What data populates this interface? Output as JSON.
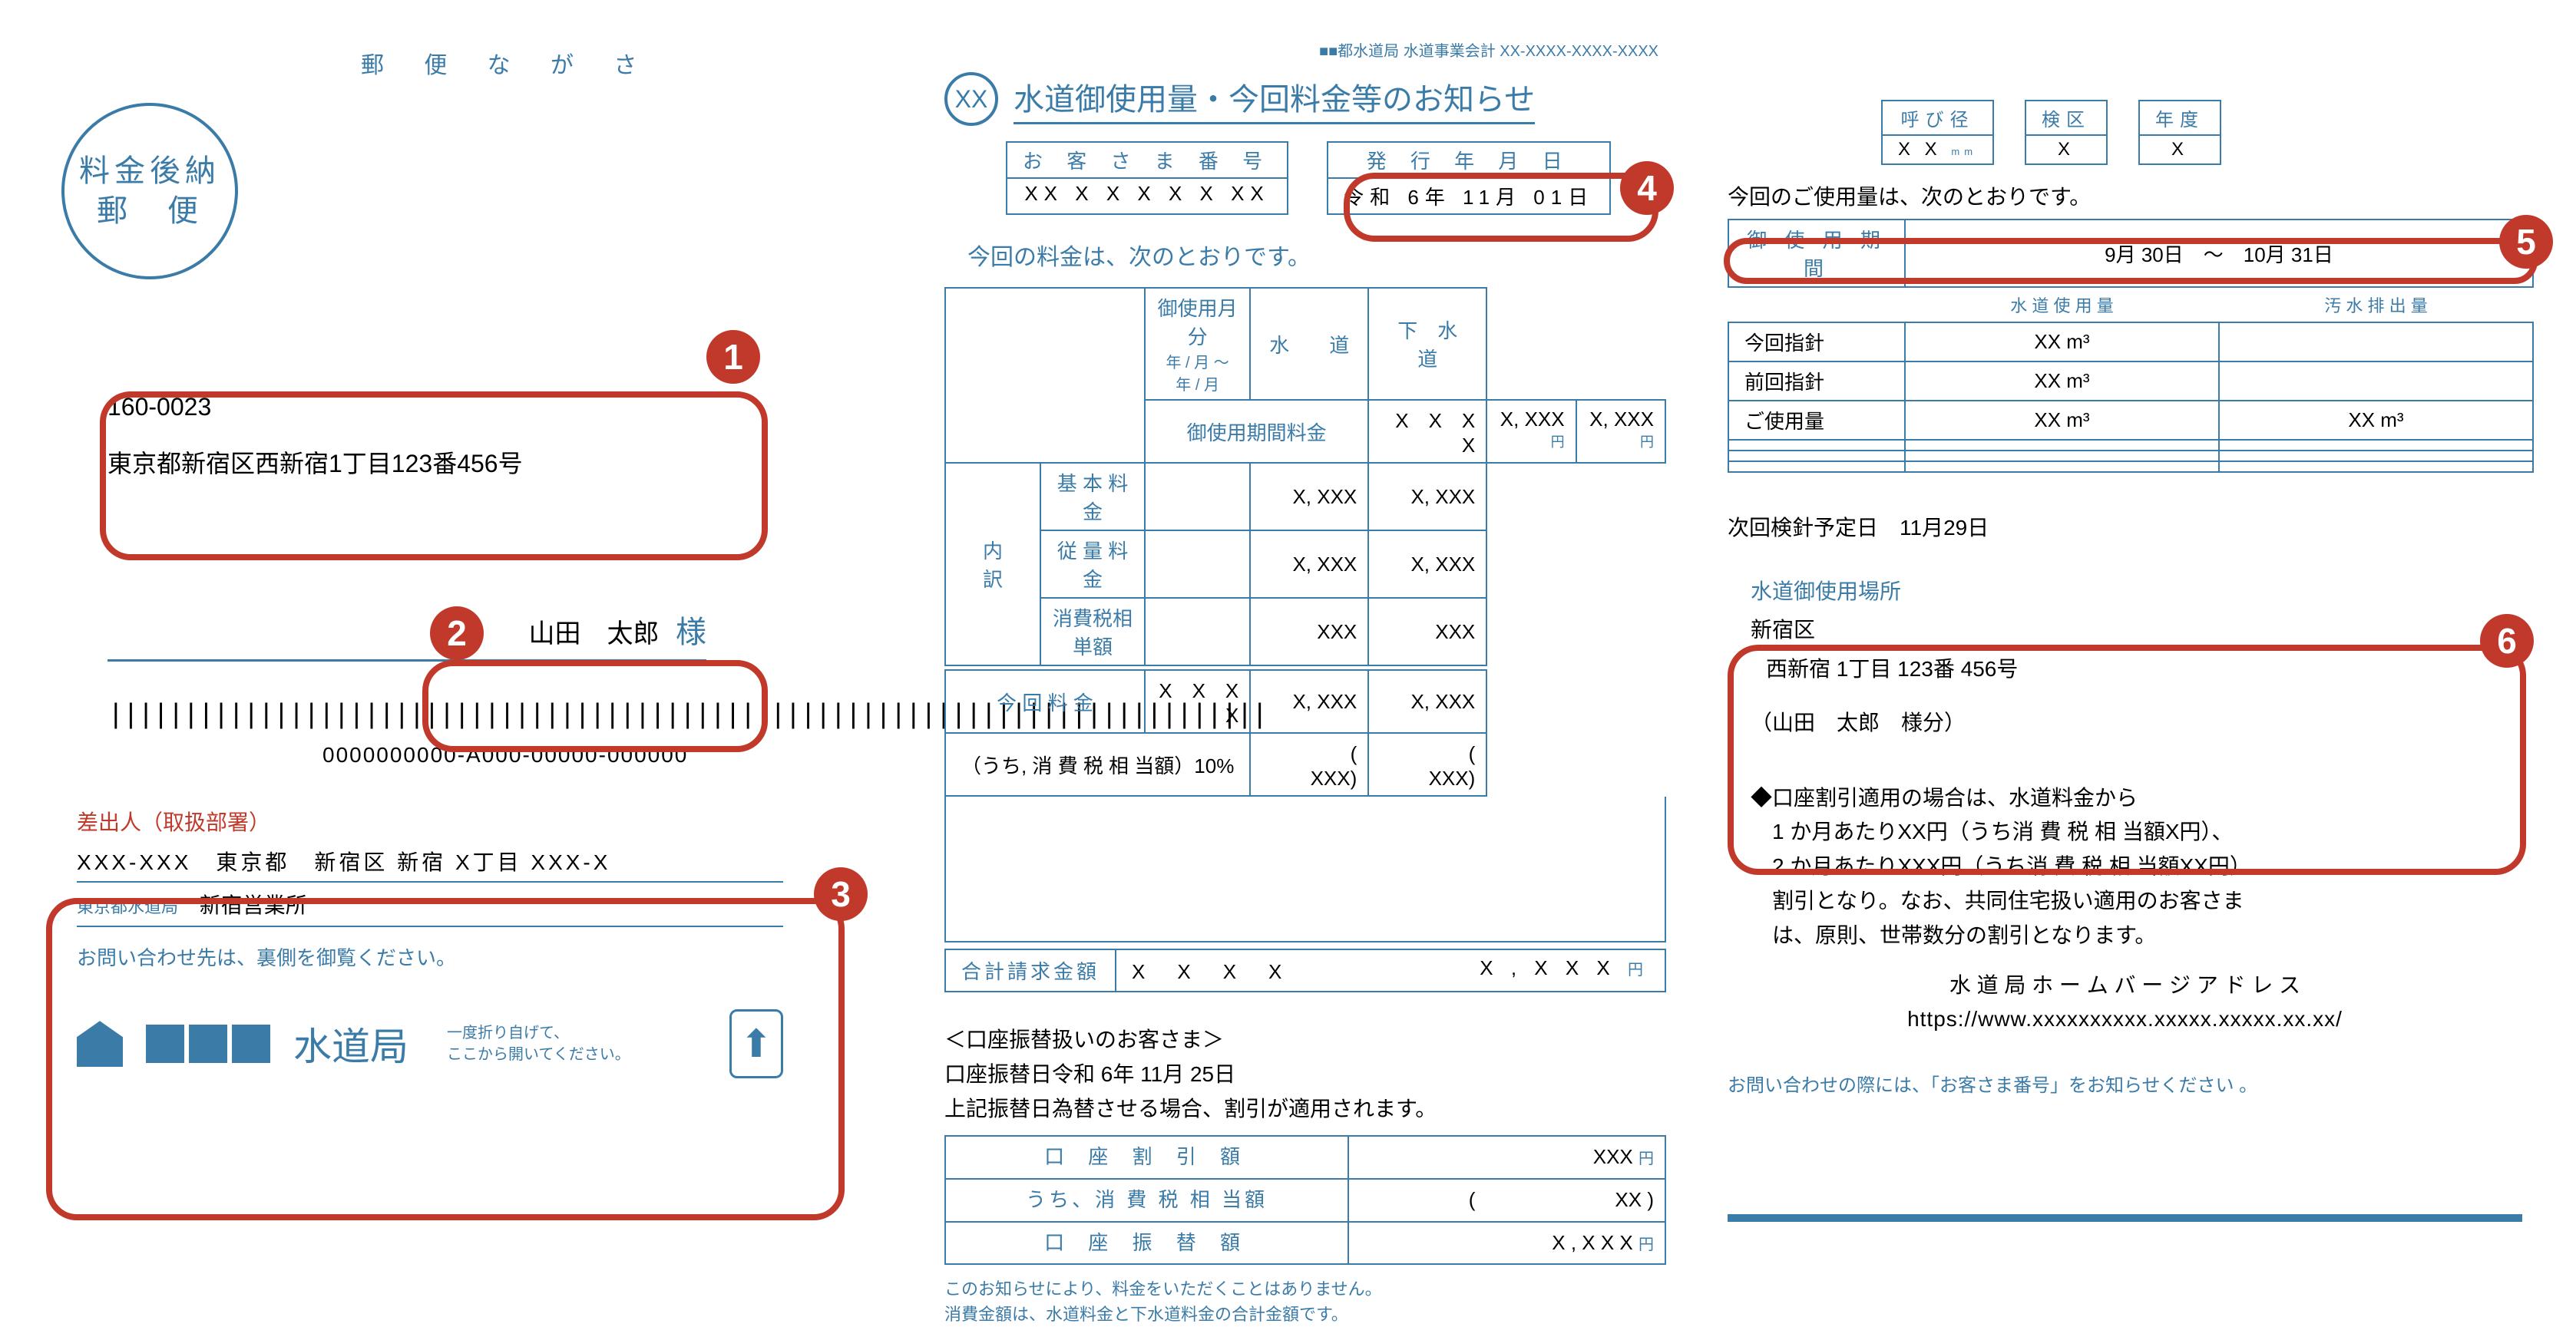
{
  "left": {
    "yuubin_header": "郵 便 な が さ",
    "stamp_line1": "料金後納",
    "stamp_line2": "郵　便",
    "postal_code": "160-0023",
    "address": "東京都新宿区西新宿1丁目123番456号",
    "name": "山田　太郎",
    "name_suffix": "様",
    "barcode": "|||||||||||||||||||||||||||||||||||||||||||||||||||||||||||||||||||||||||||||",
    "barcode_number": "0000000000-A000-00000-000000",
    "sender": {
      "title": "差出人（取扱部署）",
      "addr": "XXX-XXX　東京都　新宿区 新宿 X丁目 XXX-X",
      "dept_small": "東京都水道局",
      "office": "新宿営業所",
      "note": "お問い合わせ先は、裏側を御覧ください。"
    },
    "dept": {
      "title": "水道局",
      "note1": "一度折り自げて、",
      "note2": "ここから開いてください。"
    }
  },
  "mid": {
    "account_line": "■■都水道局 水道事業会計  XX-XXXX-XXXX-XXXX",
    "xx": "XX",
    "notice_title": "水道御使用量・今回料金等のお知らせ",
    "customer_no_h": "お 客 さ ま 番 号",
    "customer_no_v": "XX  X X X X X  XX",
    "issue_date_h": "発 行 年 月 日",
    "issue_date_v": "令和  6年 11月 01日",
    "intro": "今回の料金は、次のとおりです。",
    "tbl": {
      "h_months": "御使用月分",
      "h_months_sub": "年 / 月 ～ 年 / 月",
      "h_water": "水　　道",
      "h_sewer": "下　水　道",
      "r_period": "御使用期間料金",
      "v_period_months": "X　X　X　X",
      "v_period_water": "X, XXX",
      "v_period_sewer": "X, XXX",
      "breakdown": "内　　訳",
      "r_base": "基 本 料 金",
      "v_base_water": "X, XXX",
      "v_base_sewer": "X, XXX",
      "r_metered": "従 量 料 金",
      "v_metered_water": "X, XXX",
      "v_metered_sewer": "X, XXX",
      "r_tax": "消費税相単額",
      "v_tax_water": "XXX",
      "v_tax_sewer": "XXX",
      "r_current": "今 回 料 金",
      "v_current_months": "X　X　X　X",
      "v_current_water": "X, XXX",
      "v_current_sewer": "X, XXX",
      "r_taxinc": "（うち, 消 費 税 相 当額）10%",
      "v_taxinc_water": "(　　　XXX)",
      "v_taxinc_sewer": "(　　　XXX)"
    },
    "total_h": "合計請求金額",
    "total_v_months": "X　X　X　X",
    "total_v": "X , X X X",
    "yen": "円",
    "transfer": {
      "title": "＜口座振替扱いのお客さま＞",
      "line1": "口座振替日令和  6年 11月 25日",
      "line2": "上記振替日為替させる場合、割引が適用されます。",
      "h_discount": "口 座 割 引 額",
      "v_discount": "XXX",
      "h_tax": "うち、消 費 税 相 当額",
      "v_tax": "(　　　　　　　XX )",
      "h_transfer": "口 座 振 替 額",
      "v_transfer": "X , X X X"
    },
    "footnote1": "このお知らせにより、料金をいただくことはありません。",
    "footnote2": "消費金額は、水道料金と下水道料金の合計金額です。"
  },
  "right": {
    "spec": {
      "diameter_h": "呼び径",
      "diameter_v": "X X",
      "diameter_u": "mm",
      "ward_h": "検区",
      "ward_v": "X",
      "year_h": "年度",
      "year_v": "X"
    },
    "usage_intro": "今回のご使用量は、次のとおりです。",
    "usage_tbl": {
      "h_period": "御 使 用 期 間",
      "v_period": "9月  30日　～　10月  31日",
      "subh_water": "水 道 使 用 量",
      "subh_sewer": "汚 水 排 出 量",
      "r_current": "今回指針",
      "v_current_reading": "XX  m³",
      "r_prev": "前回指針",
      "v_prev_reading": "XX  m³",
      "r_usage": "ご使用量",
      "v_usage_water": "XX  m³",
      "v_usage_sewer": "XX  m³"
    },
    "next_date_label": "次回検針予定日",
    "next_date": "11月29日",
    "location": {
      "title": "水道御使用場所",
      "line1": "新宿区",
      "line2": "西新宿  1丁目  123番  456号",
      "line3": "（山田　太郎　様分）"
    },
    "discount": "◆口座割引適用の場合は、水道料金から\n　1 か月あたりXX円（うち消 費 税 相 当額X円）、\n　2 か月あたりXXX円（うち消 費 税 相 当額XX円）\n　割引となり。なお、共同住宅扱い適用のお客さま\n　は、原則、世帯数分の割引となります。",
    "hp_label": "水 道 局 ホ ー ム バ ー ジ ア ド レ ス",
    "hp_url": "https://www.xxxxxxxxxx.xxxxx.xxxxx.xx.xx/",
    "contact_footer": "お問い合わせの際には、「お客さま番号」をお知らせください 。"
  },
  "badges": {
    "b1": "1",
    "b2": "2",
    "b3": "3",
    "b4": "4",
    "b5": "5",
    "b6": "6"
  }
}
